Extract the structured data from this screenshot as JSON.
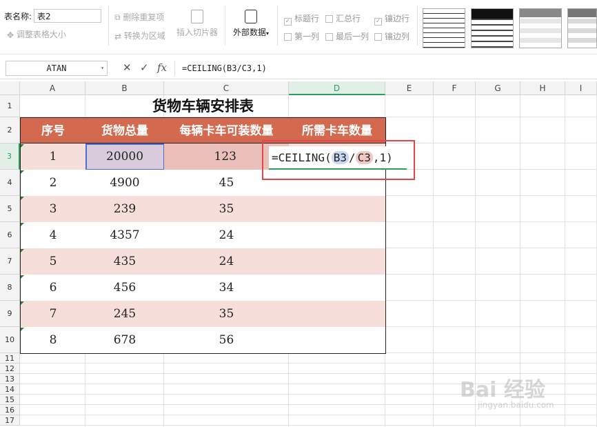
{
  "ribbon": {
    "table_name_label": "表名称:",
    "table_name_value": "表2",
    "resize_table": "调整表格大小",
    "remove_duplicates": "删除重复项",
    "convert_to_range": "转换为区域",
    "insert_slicer": "插入切片器",
    "external_data": "外部数据",
    "header_row": "标题行",
    "total_row": "汇总行",
    "banded_rows": "镶边行",
    "first_column": "第一列",
    "last_column": "最后一列",
    "banded_columns": "镶边列"
  },
  "formula_bar": {
    "name_box": "ATAN",
    "cancel": "✕",
    "confirm": "✓",
    "fx": "fx",
    "formula": "=CEILING(B3/C3,1)"
  },
  "columns": [
    "A",
    "B",
    "C",
    "D",
    "E",
    "F",
    "G",
    "H",
    "I"
  ],
  "rows": [
    "1",
    "2",
    "3",
    "4",
    "5",
    "6",
    "7",
    "8",
    "9",
    "10",
    "11",
    "12",
    "13",
    "14",
    "15",
    "16",
    "17"
  ],
  "sheet": {
    "title": "货物车辆安排表",
    "headers": [
      "序号",
      "货物总量",
      "每辆卡车可装数量",
      "所需卡车数量"
    ],
    "data": [
      [
        "1",
        "20000",
        "123",
        ""
      ],
      [
        "2",
        "4900",
        "45",
        ""
      ],
      [
        "3",
        "239",
        "35",
        ""
      ],
      [
        "4",
        "4357",
        "24",
        ""
      ],
      [
        "5",
        "435",
        "24",
        ""
      ],
      [
        "6",
        "456",
        "34",
        ""
      ],
      [
        "7",
        "245",
        "35",
        ""
      ],
      [
        "8",
        "678",
        "56",
        ""
      ]
    ]
  },
  "editor": {
    "prefix": "=CEILING(",
    "ref1": "B3",
    "slash": "/",
    "ref2": "C3",
    "suffix": ",1)"
  },
  "colors": {
    "header_fill": "#d36a4f",
    "band_fill": "#f6dfda",
    "selection_green": "#2e9c5a",
    "highlight_red": "#e64545"
  },
  "watermark": {
    "main": "Bai 经验",
    "sub": "jingyan.baidu.com"
  }
}
